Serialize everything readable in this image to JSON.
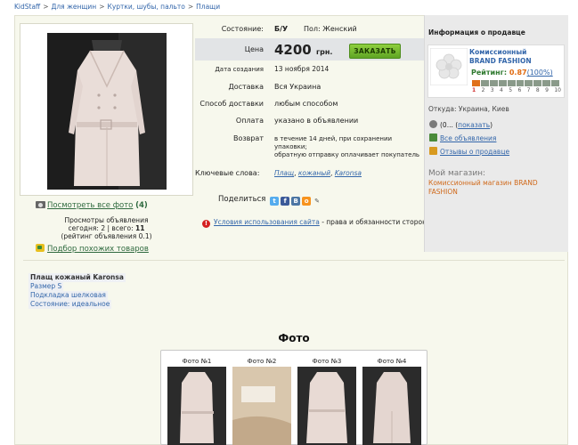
{
  "breadcrumb": [
    "KidStaff",
    "Для женщин",
    "Куртки, шубы, пальто",
    "Плащи"
  ],
  "listing": {
    "condition_label": "Состояние:",
    "condition_value": "Б/У",
    "gender": "Пол: Женский",
    "price_label": "Цена",
    "price_value": "4200",
    "currency": "грн.",
    "order_button": "ЗАКАЗАТЬ",
    "created_label": "Дата создания",
    "created_value": "13 ноября 2014",
    "delivery_label": "Доставка",
    "delivery_value": "Вся Украина",
    "delivery_method_label": "Способ доставки",
    "delivery_method_value": "любым способом",
    "payment_label": "Оплата",
    "payment_value": "указано в объявлении",
    "return_label": "Возврат",
    "return_line1": "в течение 14 дней, при сохранении",
    "return_line2": "упаковки;",
    "return_line3": "обратную отправку оплачивает покупатель",
    "keywords_label": "Ключевые слова:",
    "keywords": [
      "Плащ",
      "кожаный",
      "Karonsa"
    ]
  },
  "photo_panel": {
    "see_all": "Посмотреть все фото",
    "see_all_count": "(4)",
    "views_title": "Просмотры объявления",
    "views_today_label": "сегодня:",
    "views_today": "2",
    "views_total_label": "всего:",
    "views_total": "11",
    "views_rating": "(рейтинг объявления 0.1)",
    "similar_link": "Подбор похожих товаров"
  },
  "share": {
    "label": "Поделиться",
    "networks": [
      "twitter-icon",
      "facebook-icon",
      "vk-icon",
      "odnoklassniki-icon",
      "link-icon"
    ]
  },
  "terms": {
    "link": "Условия использования сайта",
    "suffix": "- права и обязанности сторон."
  },
  "seller": {
    "heading": "Информация о продавце",
    "name_line1": "Комиссионный",
    "name_line2": "BRAND FASHION",
    "rating_label": "Рейтинг:",
    "rating_value": "0.87",
    "rating_percent": "(100%)",
    "rating_level": 0.1,
    "scale": [
      "1",
      "2",
      "3",
      "4",
      "5",
      "6",
      "7",
      "8",
      "9",
      "10"
    ],
    "location": "Откуда: Украина, Киев",
    "phone_prefix": "(0...",
    "phone_show": "показать",
    "phone_suffix": ")",
    "all_ads": "Все объявления",
    "reviews": "Отзывы о продавце",
    "my_shop_label": "Мой магазин:",
    "shop_name": "Комиссионный магазин BRAND FASHION",
    "colors": {
      "accent": "#e0701a",
      "link": "#3366aa",
      "rating_green": "#2f7a2f"
    }
  },
  "description": {
    "title": "Плащ кожаный Karonsa",
    "lines": [
      "Размер S",
      "Подкладка шелковая",
      "Состояние: идеальное"
    ]
  },
  "photos": {
    "heading": "Фото",
    "items": [
      {
        "caption": "Фото №1",
        "kind": "coat-front"
      },
      {
        "caption": "Фото №2",
        "kind": "label"
      },
      {
        "caption": "Фото №3",
        "kind": "coat-front"
      },
      {
        "caption": "Фото №4",
        "kind": "coat-back"
      }
    ]
  }
}
